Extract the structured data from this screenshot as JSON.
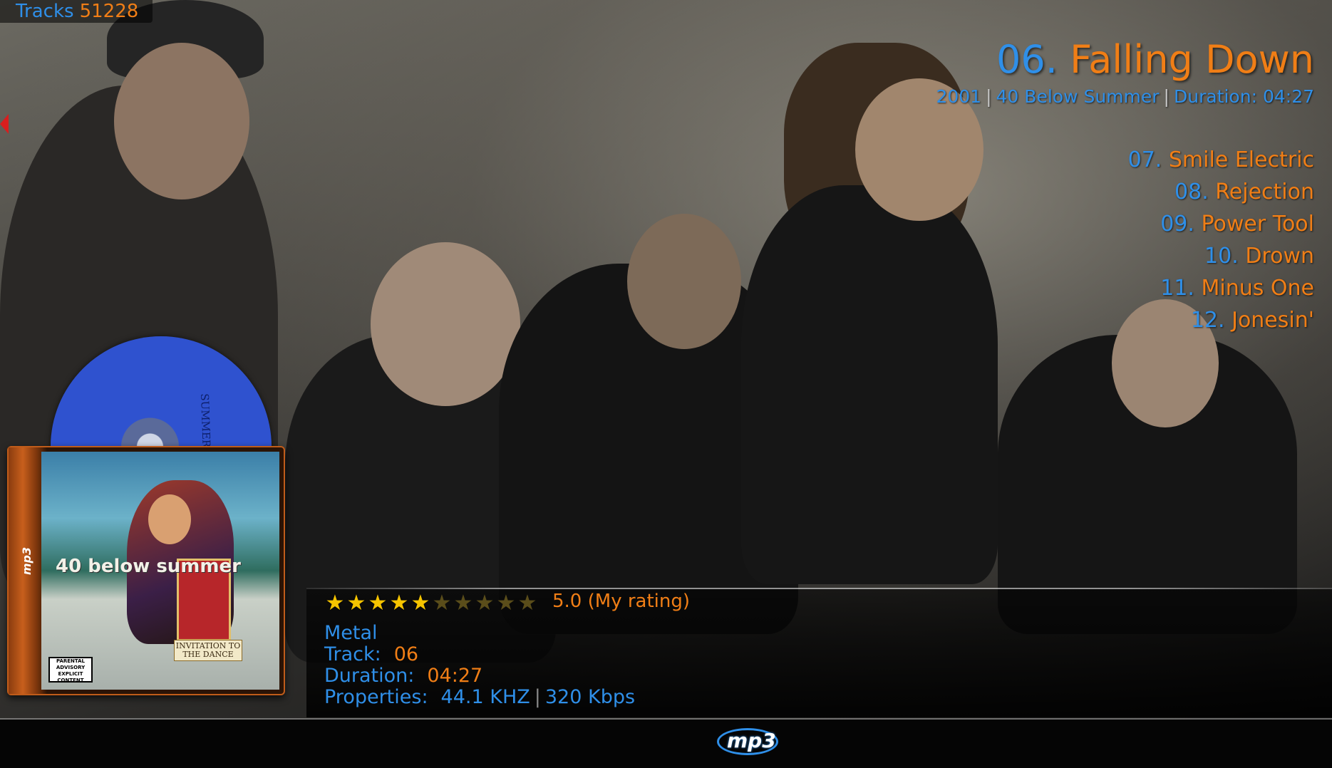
{
  "library": {
    "tracks_label": "Tracks",
    "tracks_count": "51228"
  },
  "now_playing": {
    "track_number": "06.",
    "title": "Falling Down",
    "year": "2001",
    "separator": "|",
    "artist": "40 Below Summer",
    "duration_label": "Duration:",
    "duration": "04:27"
  },
  "up_next": [
    {
      "number": "07.",
      "title": "Smile Electric"
    },
    {
      "number": "08.",
      "title": "Rejection"
    },
    {
      "number": "09.",
      "title": "Power Tool"
    },
    {
      "number": "10.",
      "title": "Drown"
    },
    {
      "number": "11.",
      "title": "Minus One"
    },
    {
      "number": "12.",
      "title": "Jonesin'"
    }
  ],
  "album_art": {
    "band_text": "40 below summer",
    "album_text": "INVITATION TO THE DANCE",
    "advisory_text": "PARENTAL ADVISORY EXPLICIT CONTENT",
    "disc_text": "SUMMER THE DANCE",
    "spine_logo": "mp3"
  },
  "rating": {
    "stars_on": 5,
    "stars_total": 10,
    "text": "5.0 (My rating)"
  },
  "info": {
    "genre": "Metal",
    "track_label": "Track:",
    "track_value": "06",
    "duration_label": "Duration:",
    "duration_value": "04:27",
    "properties_label": "Properties:",
    "sample_rate": "44.1 KHZ",
    "separator": "|",
    "bitrate": "320 Kbps"
  },
  "footer": {
    "logo_text": "mp3"
  },
  "colors": {
    "accent_orange": "#f07e16",
    "accent_blue": "#2f8fe8",
    "star_gold": "#f5c400"
  }
}
